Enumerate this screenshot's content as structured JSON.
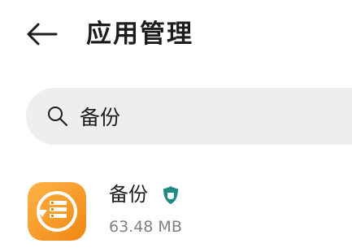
{
  "header": {
    "title": "应用管理",
    "back_icon": "arrow-left-icon"
  },
  "search": {
    "value": "备份",
    "icon": "search-icon"
  },
  "results": [
    {
      "name": "备份",
      "size": "63.48 MB",
      "icon": "backup-app-icon",
      "badge_icon": "shield-icon",
      "icon_color": "#f39a1e",
      "badge_color": "#1f8a86"
    }
  ],
  "colors": {
    "background": "#ffffff",
    "search_background": "#eeeeee",
    "text_primary": "#1c1c1c",
    "text_secondary": "#808080"
  }
}
